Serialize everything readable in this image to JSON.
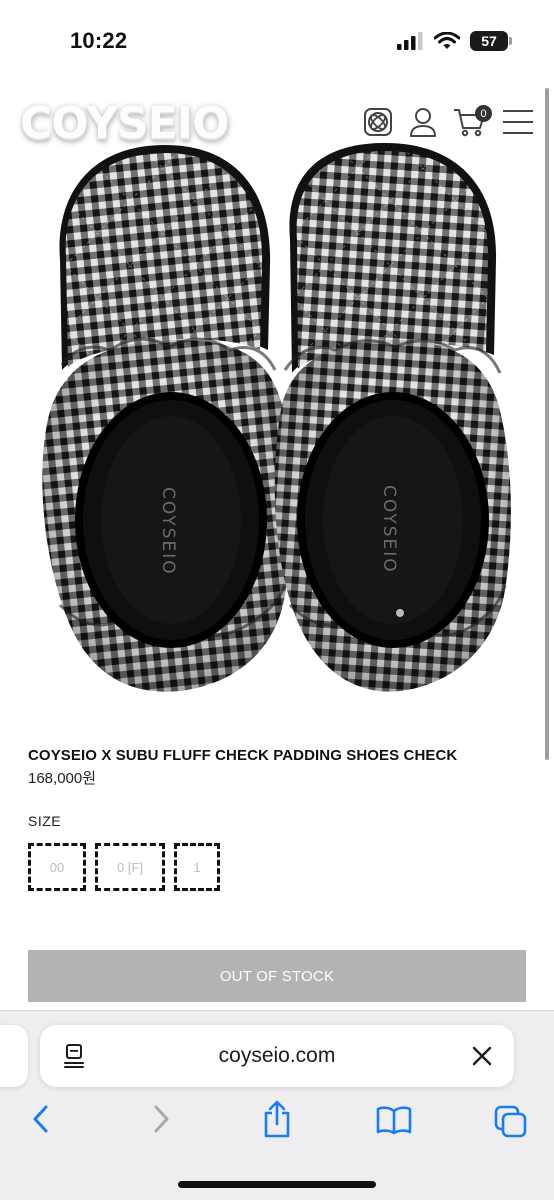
{
  "status_bar": {
    "time": "10:22",
    "battery": "57",
    "icons": [
      "signal-icon",
      "wifi-icon",
      "battery-icon"
    ]
  },
  "header": {
    "logo": "COYSEIO",
    "icons": [
      "globe-icon",
      "account-icon",
      "cart-icon",
      "menu-icon"
    ],
    "cart_count": "0"
  },
  "product": {
    "image_icon": "slippers-photo",
    "title": "COYSEIO X SUBU FLUFF CHECK PADDING SHOES CHECK",
    "price": "168,000원",
    "insole_logo": "COYSEIO",
    "size_label": "SIZE",
    "sizes": [
      "00",
      "0 [F]",
      "1"
    ],
    "cta": "OUT OF STOCK"
  },
  "browser": {
    "url": "coyseio.com",
    "icons": [
      "page-menu-icon",
      "close-icon",
      "back-icon",
      "forward-icon",
      "share-icon",
      "bookmarks-icon",
      "tabs-icon"
    ]
  },
  "colors": {
    "cta_background": "#b3b3b3",
    "browser_bar": "#eeeef0",
    "ios_blue": "#1a7cf5"
  }
}
